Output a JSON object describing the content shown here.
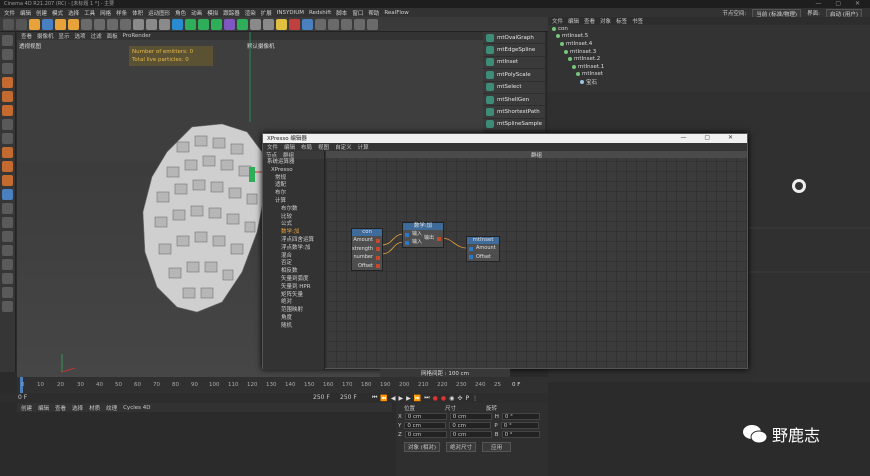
{
  "window": {
    "title": "Cinema 4D R21.207 (RC) - [未标题 1 *] - 主要",
    "controls": "— ▢ ✕"
  },
  "menubar": {
    "items": [
      "文件",
      "编辑",
      "创建",
      "模式",
      "选择",
      "工具",
      "网格",
      "样条",
      "体积",
      "运动图形",
      "角色",
      "动画",
      "模拟",
      "跟踪器",
      "渲染",
      "扩展",
      "INSYDIUM",
      "Redshift",
      "脚本",
      "窗口",
      "帮助",
      "RealFlow"
    ],
    "right": {
      "node_space_label": "节点空间:",
      "node_space_value": "当前 (标准/物理)",
      "layout_label": "界面:",
      "layout_value": "启动 (用户)"
    }
  },
  "viewport": {
    "menu": [
      "查看",
      "摄像机",
      "显示",
      "选项",
      "过滤",
      "面板",
      "ProRender"
    ],
    "view_label": "透视视图",
    "camera_label": "默认摄像机",
    "emitters_line": "Number of emitters: 0",
    "particles_line": "Total live particles: 0"
  },
  "palette": {
    "items": [
      "mtOvalGraph",
      "mtEdgeSpline",
      "mtInset",
      "mtPolyScale",
      "mtSelect",
      "mtShellGen",
      "mtShortestPath",
      "mtSplineSample"
    ]
  },
  "object_manager": {
    "menu": [
      "文件",
      "编辑",
      "查看",
      "对象",
      "标签",
      "书签"
    ],
    "rows": [
      {
        "name": "con",
        "depth": 0
      },
      {
        "name": "mtInset.5",
        "depth": 1
      },
      {
        "name": "mtInset.4",
        "depth": 2
      },
      {
        "name": "mtInset.3",
        "depth": 3
      },
      {
        "name": "mtInset.2",
        "depth": 4
      },
      {
        "name": "mtInset.1",
        "depth": 5
      },
      {
        "name": "mtInset",
        "depth": 6
      },
      {
        "name": "宝石",
        "depth": 7
      }
    ]
  },
  "xpresso": {
    "title": "XPresso 编辑器",
    "menu": [
      "文件",
      "编辑",
      "布局",
      "视图",
      "自定义",
      "计算"
    ],
    "tree_tabs": [
      "节点",
      "群组"
    ],
    "tree": [
      "系统运算器",
      "XPresso",
      "常规",
      "适配",
      "布尔",
      "计算",
      "布尔数",
      "比较",
      "公式",
      "数学:加",
      "浮点四舍运算",
      "浮点数学:加",
      "混合",
      "否定",
      "相反数",
      "矢量到弧度",
      "矢量到 HPR",
      "矩阵矢量",
      "绝对",
      "范围映射",
      "角度",
      "随机"
    ],
    "group_bar": "群组",
    "nodes": {
      "con": {
        "title": "con",
        "ports": [
          "Amount",
          "strength",
          "number",
          "Offset"
        ]
      },
      "math": {
        "title": "数学:加",
        "inputs": [
          "输入",
          "输入"
        ],
        "output": "输出"
      },
      "mtinset": {
        "title": "mtInset",
        "ports": [
          "Amount",
          "Offset"
        ]
      }
    }
  },
  "status": {
    "grid": "网格间距 : 100 cm"
  },
  "timeline": {
    "ticks": [
      "0",
      "10",
      "20",
      "30",
      "40",
      "50",
      "60",
      "70",
      "80",
      "90",
      "100",
      "110",
      "120",
      "130",
      "140",
      "150",
      "160",
      "170",
      "180",
      "190",
      "200",
      "210",
      "220",
      "230",
      "240",
      "25"
    ],
    "current": "0 F",
    "start": "0 F",
    "end": "250 F",
    "end2": "250 F"
  },
  "material": {
    "menu": [
      "创建",
      "编辑",
      "查看",
      "选择",
      "材质",
      "纹理",
      "Cycles 4D"
    ]
  },
  "coords": {
    "headers": [
      "位置",
      "尺寸",
      "旋转"
    ],
    "rows": [
      {
        "axis": "X",
        "pos": "0 cm",
        "size": "0 cm",
        "rot_label": "H",
        "rot": "0 °"
      },
      {
        "axis": "Y",
        "pos": "0 cm",
        "size": "0 cm",
        "rot_label": "P",
        "rot": "0 °"
      },
      {
        "axis": "Z",
        "pos": "0 cm",
        "size": "0 cm",
        "rot_label": "B",
        "rot": "0 °"
      }
    ],
    "mode": "对象 (相对)",
    "size_mode": "绝对尺寸",
    "apply": "应用"
  },
  "watermark": {
    "text": "野鹿志"
  },
  "colors": {
    "accent": "#3f6b9a",
    "port_in": "#2a78c8",
    "port_out": "#c8482a",
    "emitter_text": "#e6b94a",
    "palette_icon": "#3c8c78"
  }
}
